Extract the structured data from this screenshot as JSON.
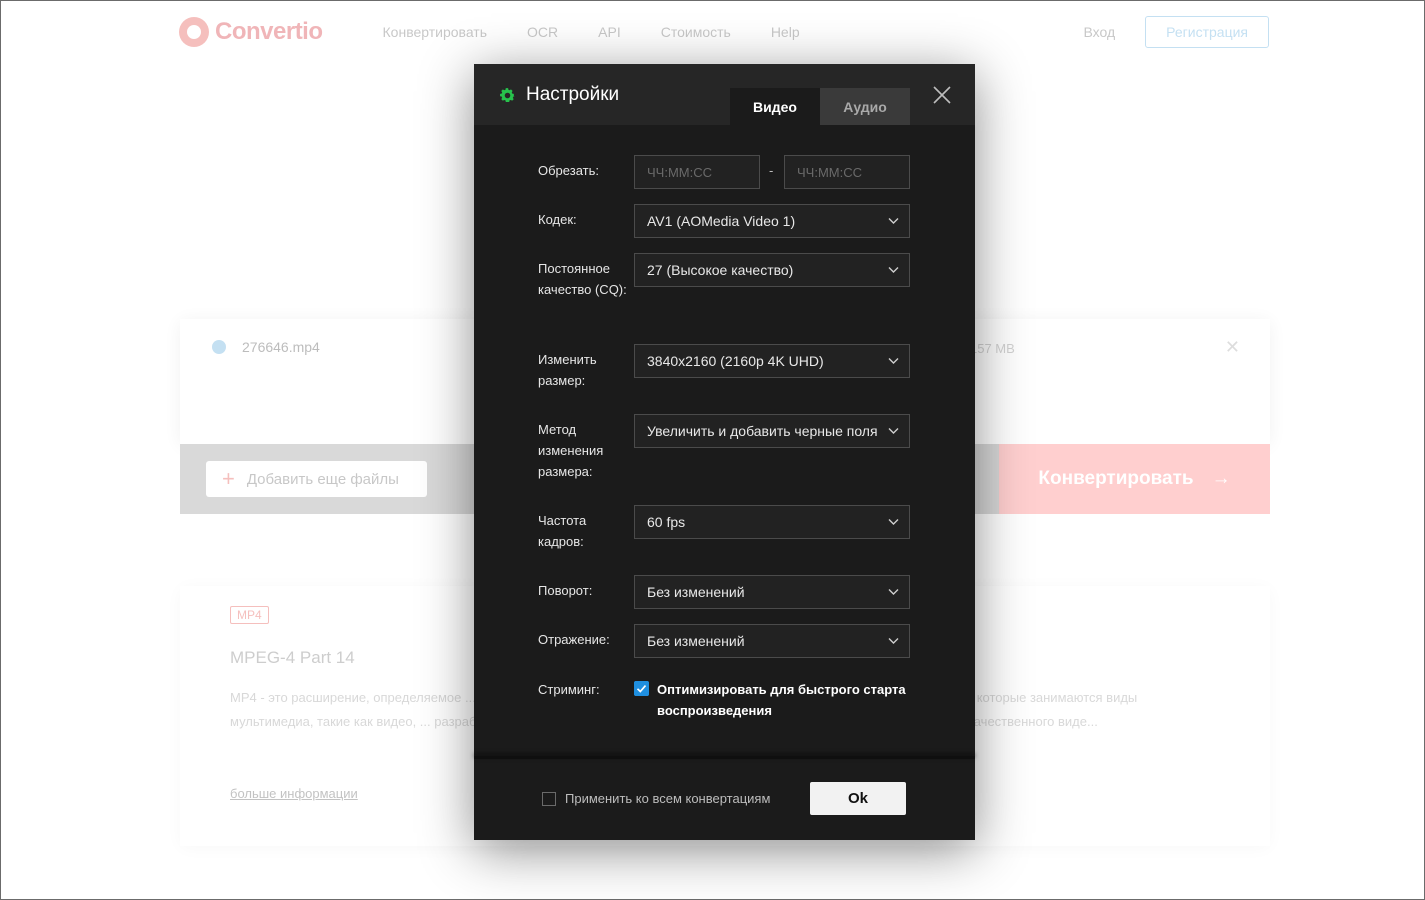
{
  "background": {
    "logo_text": "Convertio",
    "nav": [
      "Конвертировать",
      "OCR",
      "API",
      "Стоимость",
      "Help"
    ],
    "login": "Вход",
    "register": "Регистрация",
    "file_name": "276646.mp4",
    "file_size": "157 MB",
    "add_files": "Добавить еще файлы",
    "convert": "Конвертировать",
    "format_badge": "MP4",
    "format_title": "MPEG-4 Part 14",
    "format_text": "MP4 - это расширение, определяемое ... кодек, разработанный Alliance for Open стандартом аудио AAC. Это контейнер... , которые занимаются виды мультимедиа, такие как видео, ... разработкой веб-браузеров. Кодек графика. Файл MP4 можно открыть ... правки высококачественного виде...",
    "more_info": "больше информации"
  },
  "modal": {
    "title": "Настройки",
    "tabs": {
      "video": "Видео",
      "audio": "Аудио"
    },
    "trim": {
      "label": "Обрезать:",
      "start_placeholder": "ЧЧ:ММ:СС",
      "end_placeholder": "ЧЧ:ММ:СС",
      "separator": "-"
    },
    "codec": {
      "label": "Кодек:",
      "value": "AV1 (AOMedia Video 1)"
    },
    "cq": {
      "label": "Постоянное качество (CQ):",
      "value": "27 (Высокое качество)"
    },
    "resize": {
      "label": "Изменить размер:",
      "value": "3840x2160 (2160p 4K UHD)"
    },
    "resize_method": {
      "label": "Метод изменения размера:",
      "value": "Увеличить и добавить черные поля"
    },
    "framerate": {
      "label": "Частота кадров:",
      "value": "60 fps"
    },
    "rotate": {
      "label": "Поворот:",
      "value": "Без изменений"
    },
    "flip": {
      "label": "Отражение:",
      "value": "Без изменений"
    },
    "streaming": {
      "label": "Стриминг:",
      "checkbox_text": "Оптимизировать для быстрого старта воспроизведения",
      "checked": true
    },
    "apply_all": {
      "label": "Применить ко всем конвертациям",
      "checked": false
    },
    "ok": "Ok"
  },
  "colors": {
    "accent_green": "#27c24c",
    "checkbox_blue": "#1f8fe0",
    "brand_red": "#e23b35"
  }
}
